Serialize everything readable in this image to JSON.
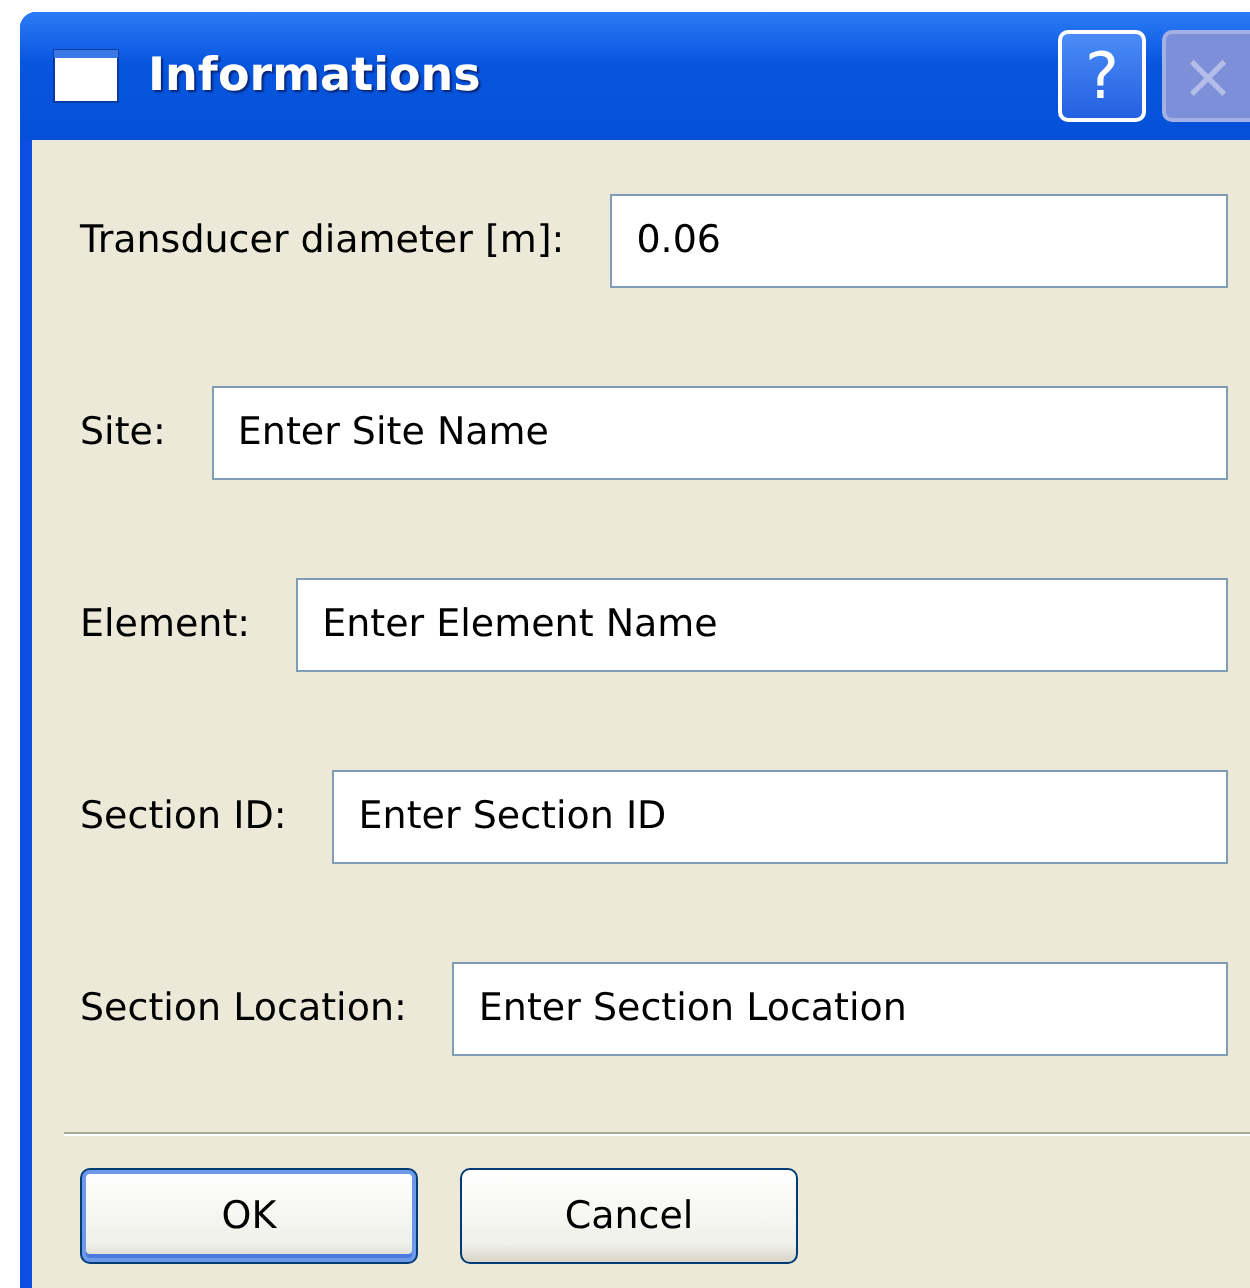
{
  "window": {
    "title": "Informations",
    "help_button": "?",
    "close_button": {
      "label": "×",
      "disabled": true
    }
  },
  "fields": [
    {
      "label": "Transducer diameter [m]:",
      "value": "0.06"
    },
    {
      "label": "Site:",
      "value": "Enter Site Name"
    },
    {
      "label": "Element:",
      "value": "Enter Element Name"
    },
    {
      "label": "Section ID:",
      "value": "Enter Section ID"
    },
    {
      "label": "Section Location:",
      "value": "Enter Section Location"
    }
  ],
  "buttons": [
    {
      "label": "OK",
      "default": true
    },
    {
      "label": "Cancel",
      "default": false
    }
  ]
}
